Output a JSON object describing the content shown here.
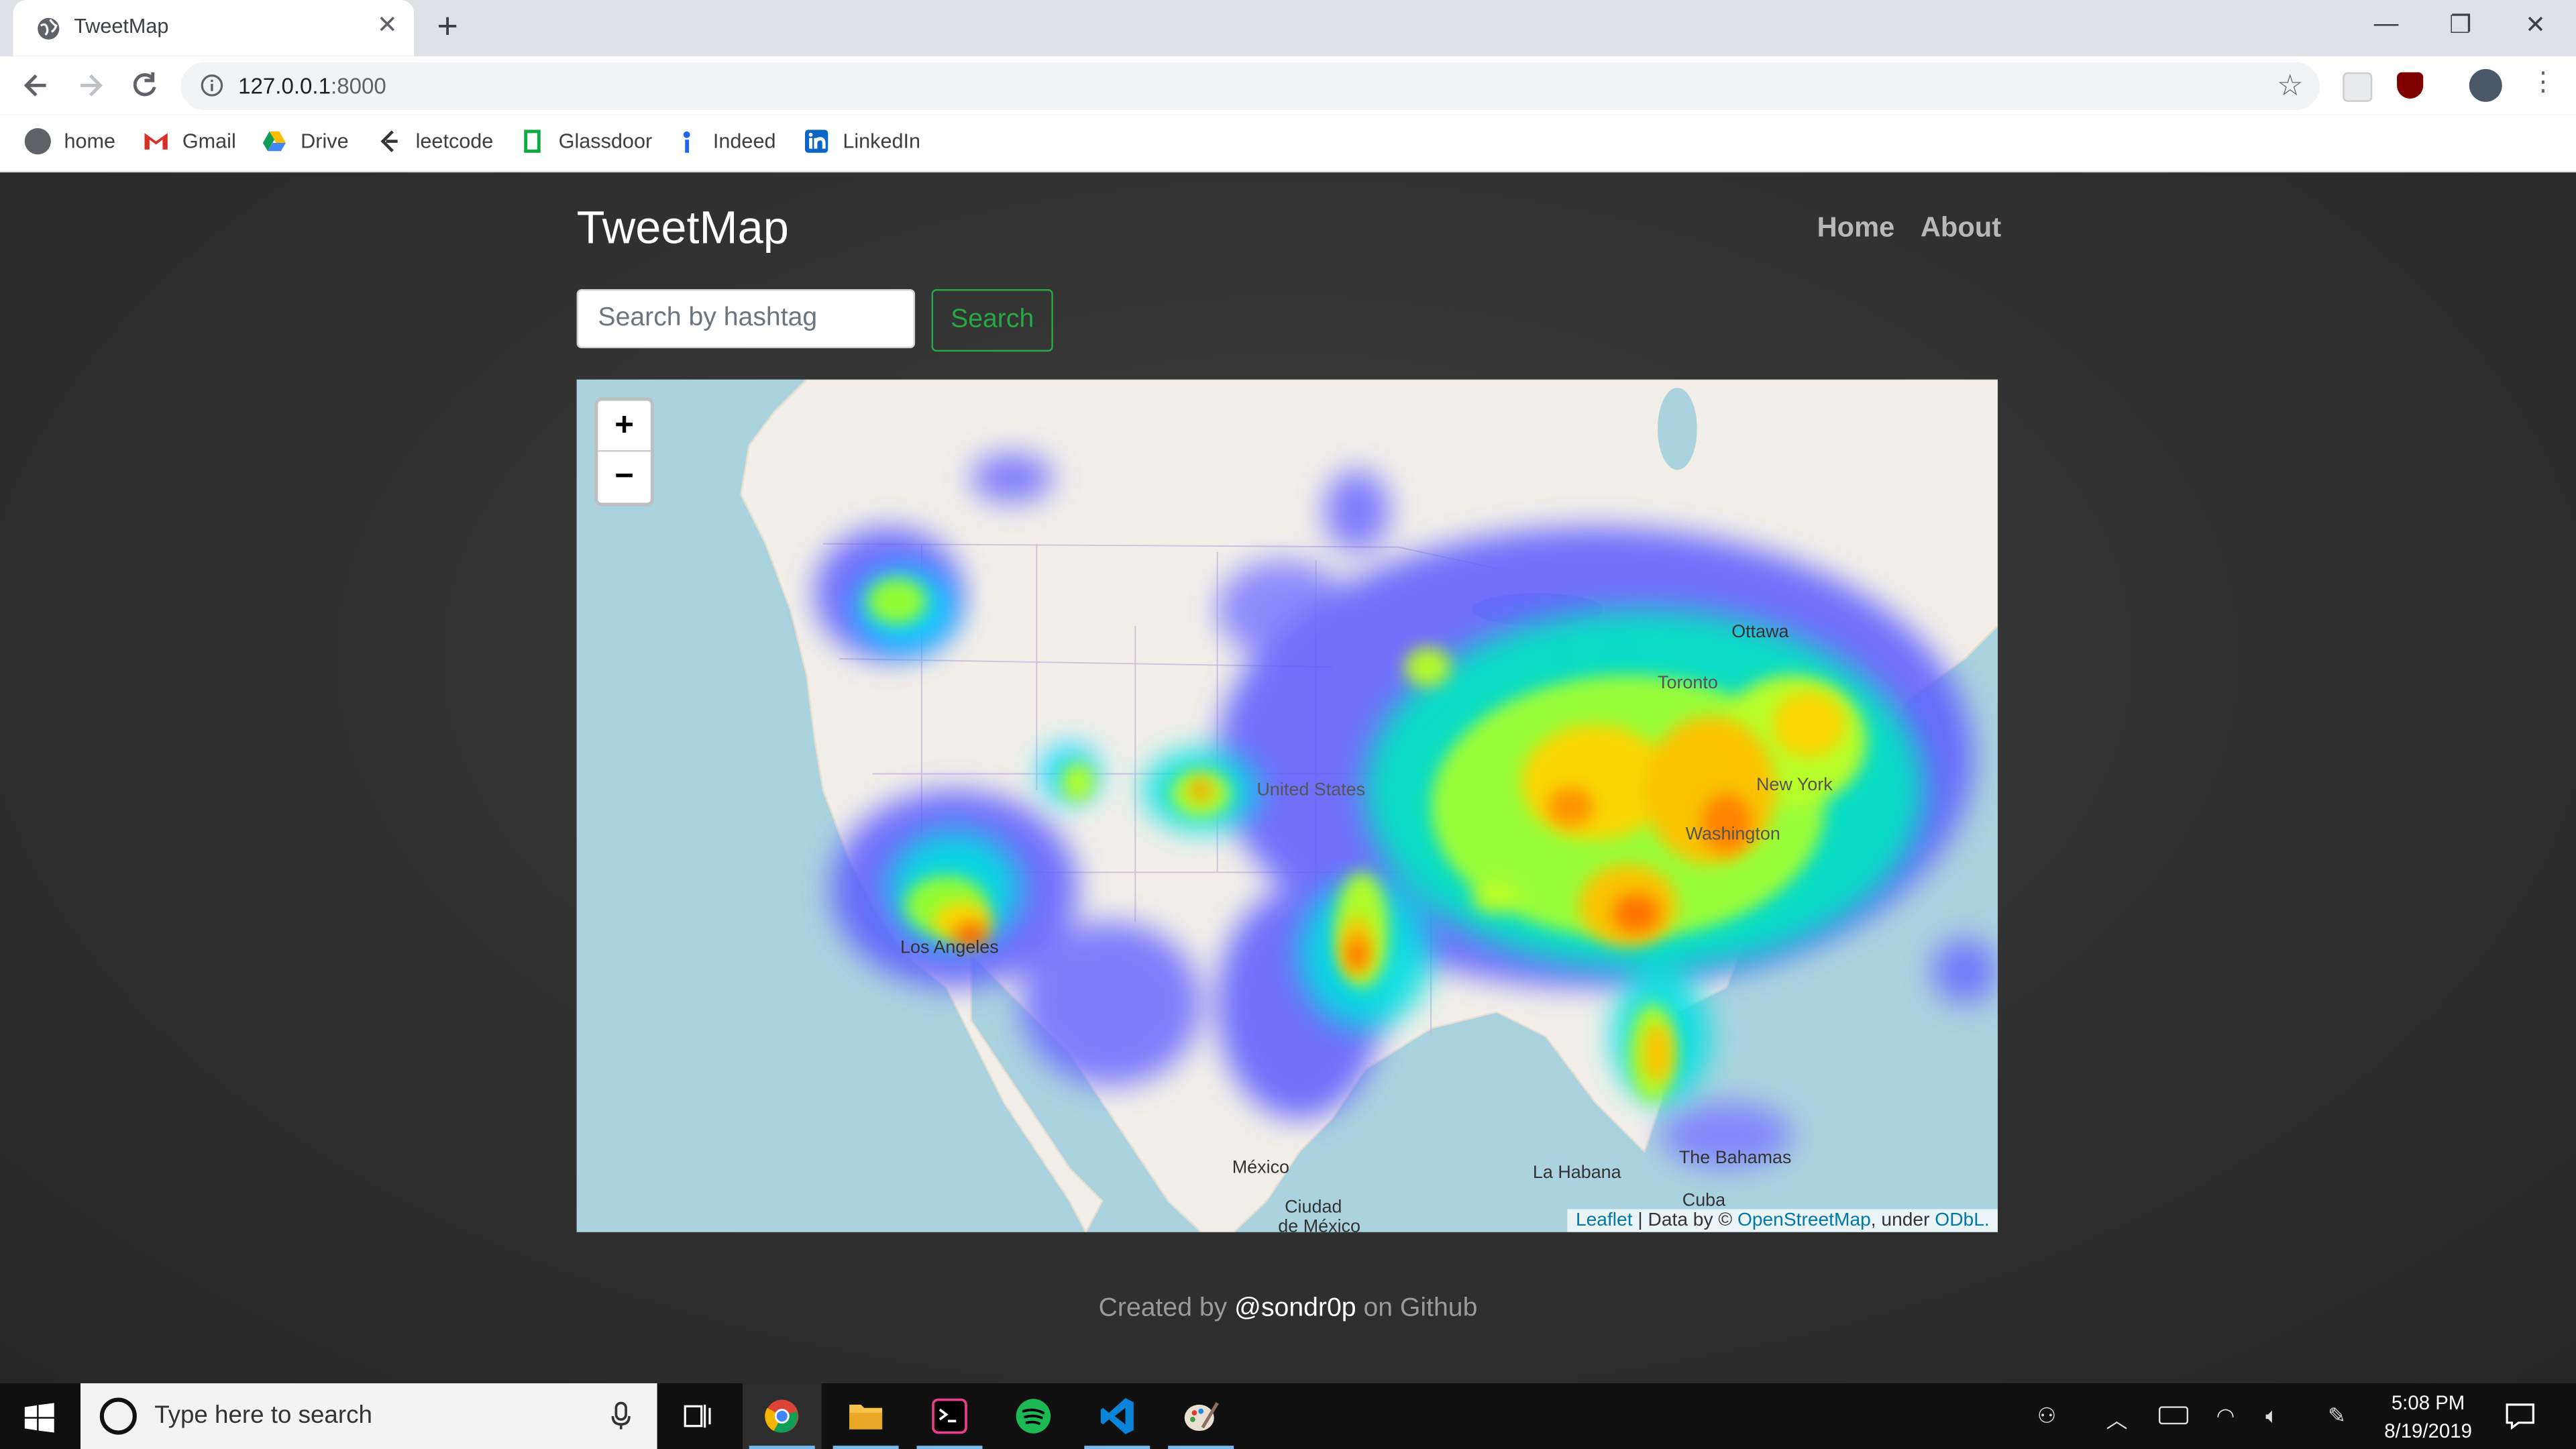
{
  "browser": {
    "tab_title": "TweetMap",
    "url_host": "127.0.0.1",
    "url_port": ":8000",
    "bookmarks": [
      "home",
      "Gmail",
      "Drive",
      "leetcode",
      "Glassdoor",
      "Indeed",
      "LinkedIn"
    ]
  },
  "app": {
    "brand": "TweetMap",
    "nav": {
      "home": "Home",
      "about": "About"
    },
    "search": {
      "placeholder": "Search by hashtag",
      "button": "Search"
    }
  },
  "map": {
    "zoom_in": "+",
    "zoom_out": "−",
    "labels": {
      "ottawa": "Ottawa",
      "toronto": "Toronto",
      "united_states": "United States",
      "new_york": "New York",
      "washington": "Washington",
      "los_angeles": "Los Angeles",
      "mexico": "México",
      "ciudad": "Ciudad",
      "de_mexico": "de México",
      "la_habana": "La Habana",
      "bahamas": "The Bahamas",
      "cuba": "Cuba"
    },
    "attribution": {
      "leaflet": "Leaflet",
      "data_by": " | Data by © ",
      "osm": "OpenStreetMap",
      "under": ", under ",
      "odbl": "ODbL."
    },
    "heatmap": "tweet density heatmap over the United States"
  },
  "footer": {
    "prefix": "Created by ",
    "handle": "@sondr0p",
    "suffix": " on Github"
  },
  "taskbar": {
    "search_placeholder": "Type here to search",
    "time": "5:08 PM",
    "date": "8/19/2019"
  },
  "colors": {
    "accent_green": "#28a745",
    "page_bg": "#2d2d2d",
    "water": "#aad3df",
    "land": "#f2efe9"
  }
}
